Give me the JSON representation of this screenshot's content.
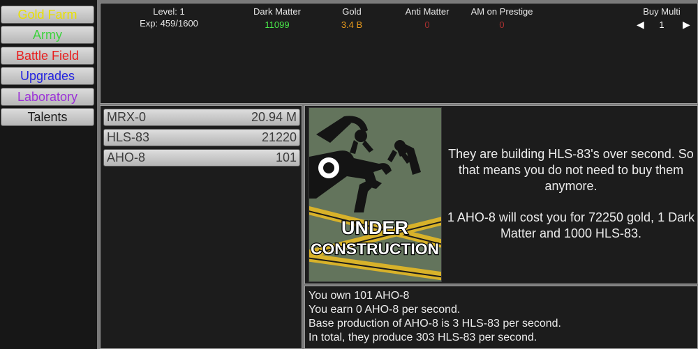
{
  "nav": {
    "items": [
      {
        "label": "Gold Farm",
        "color": "#e8e000"
      },
      {
        "label": "Army",
        "color": "#3ed23e"
      },
      {
        "label": "Battle Field",
        "color": "#e81e1e"
      },
      {
        "label": "Upgrades",
        "color": "#2222e0"
      },
      {
        "label": "Laboratory",
        "color": "#9b30d8"
      },
      {
        "label": "Talents",
        "color": "#1a1a1a"
      }
    ]
  },
  "stats": {
    "level_label": "Level: 1",
    "exp_label": "Exp: 459/1600",
    "dark_matter_label": "Dark Matter",
    "dark_matter_value": "11099",
    "gold_label": "Gold",
    "gold_value": "3.4 B",
    "anti_matter_label": "Anti Matter",
    "anti_matter_value": "0",
    "am_prestige_label": "AM on Prestige",
    "am_prestige_value": "0",
    "buy_multi_label": "Buy Multi",
    "buy_multi_value": "1",
    "colors": {
      "dark_matter": "#49e649",
      "gold": "#e89a1c",
      "anti_matter": "#a83030"
    }
  },
  "units": [
    {
      "name": "MRX-0",
      "value": "20.94 M"
    },
    {
      "name": "HLS-83",
      "value": "21220"
    },
    {
      "name": "AHO-8",
      "value": "101"
    }
  ],
  "info": {
    "image_text_line1": "UNDER",
    "image_text_line2": "CONSTRUCTION",
    "image_icon": "robot-arms-wrench-icon",
    "desc_line1": "They are building HLS-83's over second. So that means you do not need to buy them anymore.",
    "desc_line2": "1 AHO-8 will cost you for 72250 gold, 1 Dark Matter and 1000 HLS-83."
  },
  "details": {
    "line1": "You own 101 AHO-8",
    "line2": "You earn 0 AHO-8 per second.",
    "line3": "Base production of AHO-8 is 3 HLS-83 per second.",
    "line4": "In total, they produce 303 HLS-83 per second."
  }
}
